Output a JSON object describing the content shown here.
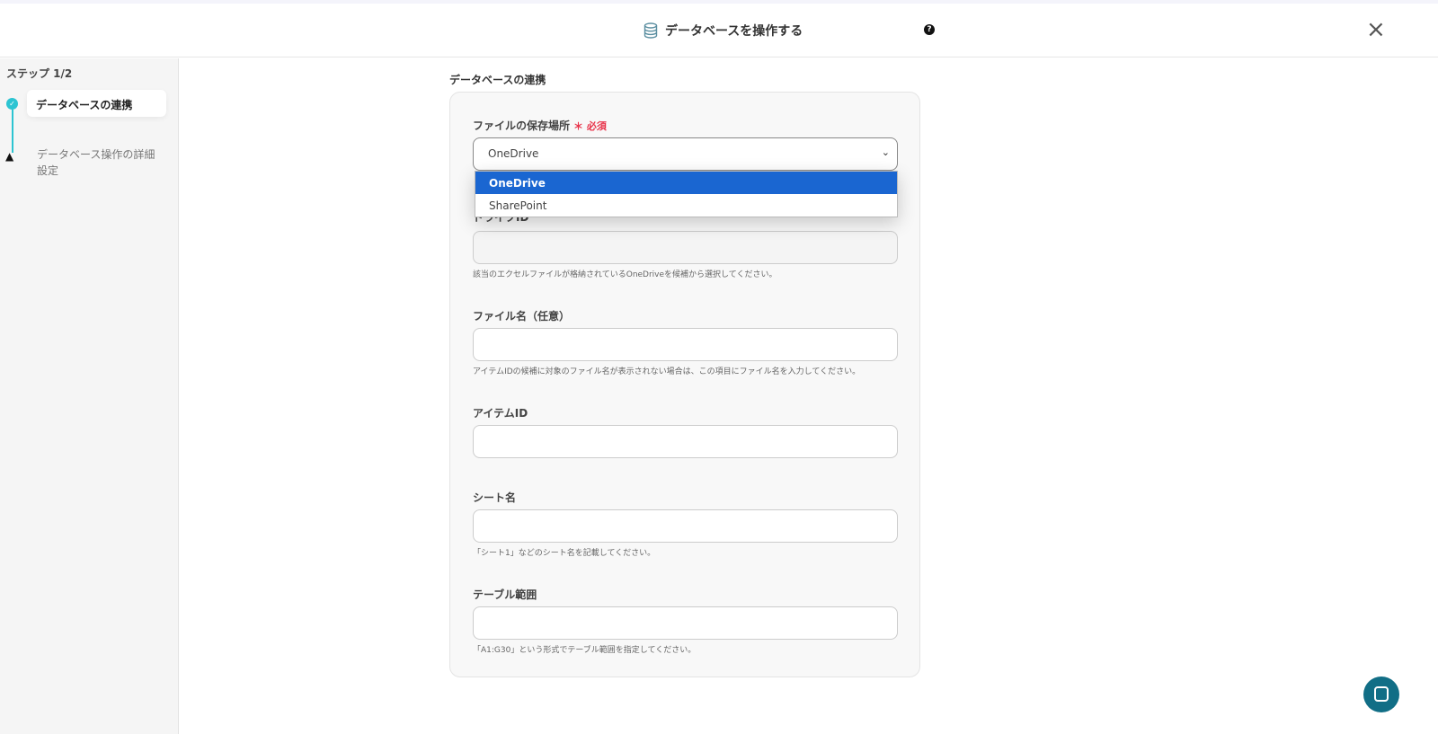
{
  "header": {
    "title": "データベースを操作する",
    "help": "?",
    "close": "×"
  },
  "sidebar": {
    "step_label": "ステップ 1/2",
    "steps": [
      {
        "label": "データベースの連携"
      },
      {
        "label": "データベース操作の詳細設定"
      }
    ]
  },
  "main": {
    "section_title": "データベースの連携",
    "storage": {
      "label": "ファイルの保存場所",
      "required": "＊ 必須",
      "value": "OneDrive",
      "options": [
        "OneDrive",
        "SharePoint"
      ]
    },
    "drive": {
      "label": "ドライブID",
      "hint": "該当のエクセルファイルが格納されているOneDriveを候補から選択してください。"
    },
    "filename": {
      "label": "ファイル名（任意）",
      "hint": "アイテムIDの候補に対象のファイル名が表示されない場合は、この項目にファイル名を入力してください。"
    },
    "item": {
      "label": "アイテムID"
    },
    "sheet": {
      "label": "シート名",
      "hint": "「シート1」などのシート名を記載してください。"
    },
    "range": {
      "label": "テーブル範囲",
      "hint": "「A1:G30」という形式でテーブル範囲を指定してください。"
    }
  }
}
